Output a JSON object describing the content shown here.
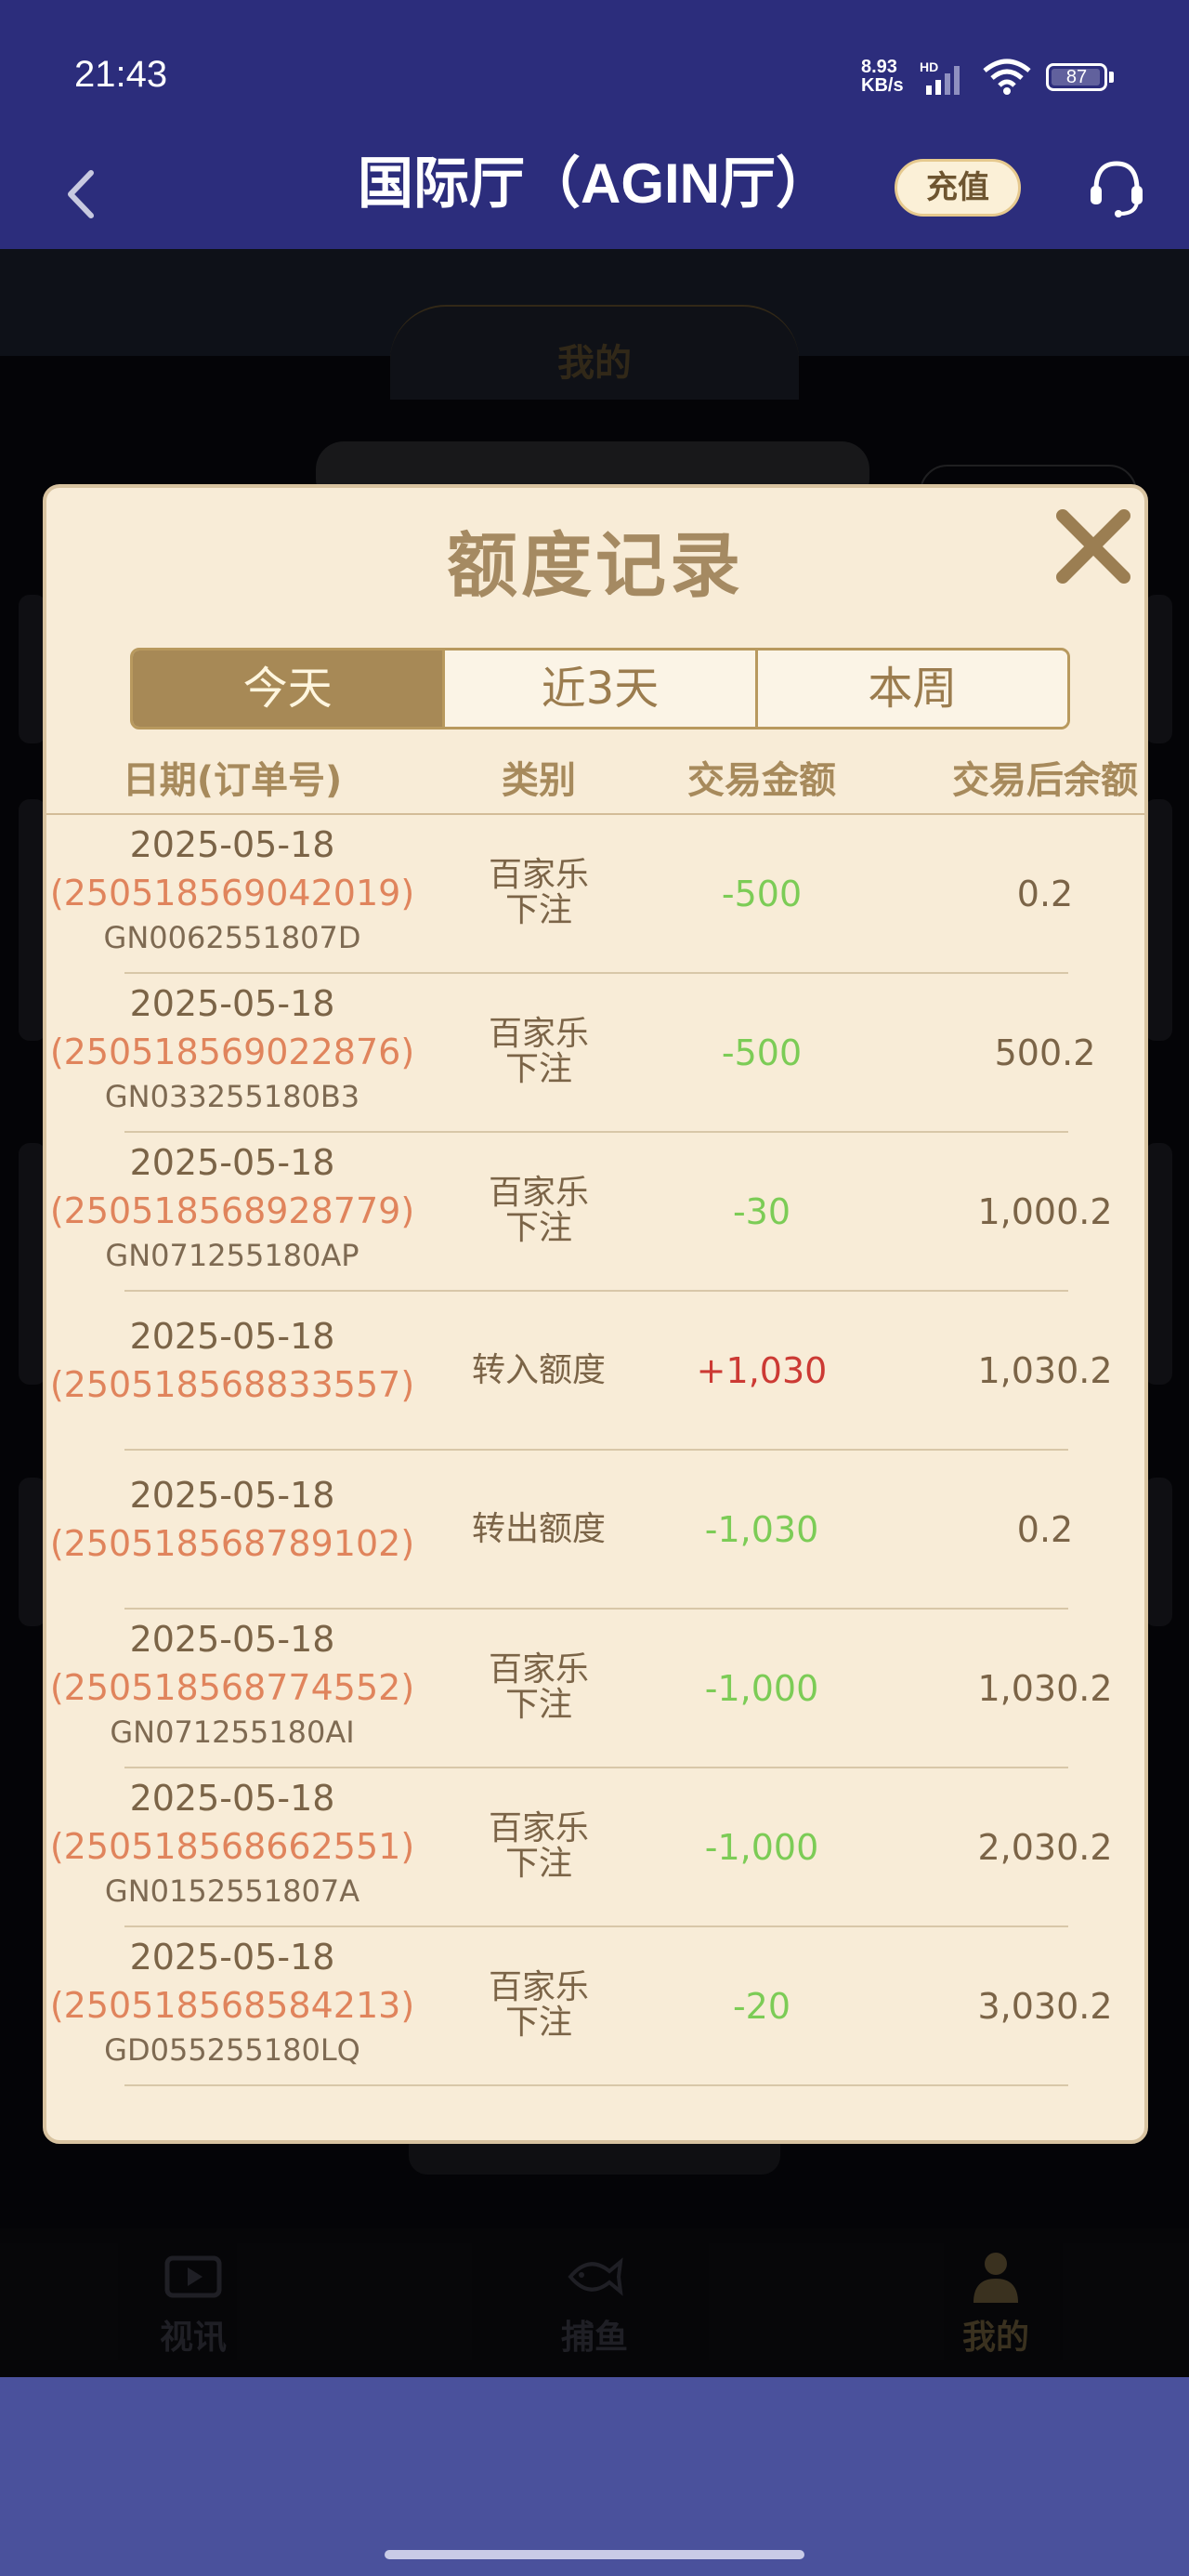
{
  "status_bar": {
    "time": "21:43",
    "net_speed_value": "8.93",
    "net_speed_unit": "KB/s",
    "net_type": "HD",
    "battery": "87"
  },
  "header": {
    "title": "国际厅（AGIN厅）",
    "recharge_label": "充值"
  },
  "background": {
    "tab_label": "我的"
  },
  "bottom_nav": {
    "items": [
      {
        "label": "视讯",
        "icon": "video-icon"
      },
      {
        "label": "捕鱼",
        "icon": "fish-icon"
      },
      {
        "label": "我的",
        "icon": "user-icon"
      }
    ]
  },
  "modal": {
    "title": "额度记录",
    "tabs": [
      {
        "label": "今天",
        "active": true
      },
      {
        "label": "近3天",
        "active": false
      },
      {
        "label": "本周",
        "active": false
      }
    ],
    "columns": {
      "date": "日期(订单号)",
      "type": "类别",
      "amount": "交易金额",
      "balance": "交易后余额"
    },
    "rows": [
      {
        "date": "2025-05-18",
        "order": "(250518569042019)",
        "gn": "GN0062551807D",
        "type": "百家乐下注",
        "amount": "-500",
        "balance": "0.2"
      },
      {
        "date": "2025-05-18",
        "order": "(250518569022876)",
        "gn": "GN033255180B3",
        "type": "百家乐下注",
        "amount": "-500",
        "balance": "500.2"
      },
      {
        "date": "2025-05-18",
        "order": "(250518568928779)",
        "gn": "GN071255180AP",
        "type": "百家乐下注",
        "amount": "-30",
        "balance": "1,000.2"
      },
      {
        "date": "2025-05-18",
        "order": "(250518568833557)",
        "gn": "",
        "type": "转入额度",
        "amount": "+1,030",
        "balance": "1,030.2"
      },
      {
        "date": "2025-05-18",
        "order": "(250518568789102)",
        "gn": "",
        "type": "转出额度",
        "amount": "-1,030",
        "balance": "0.2"
      },
      {
        "date": "2025-05-18",
        "order": "(250518568774552)",
        "gn": "GN071255180AI",
        "type": "百家乐下注",
        "amount": "-1,000",
        "balance": "1,030.2"
      },
      {
        "date": "2025-05-18",
        "order": "(250518568662551)",
        "gn": "GN0152551807A",
        "type": "百家乐下注",
        "amount": "-1,000",
        "balance": "2,030.2"
      },
      {
        "date": "2025-05-18",
        "order": "(250518568584213)",
        "gn": "GD055255180LQ",
        "type": "百家乐下注",
        "amount": "-20",
        "balance": "3,030.2"
      }
    ]
  },
  "colors": {
    "header_bg": "#2c2d7c",
    "modal_bg": "#f8ecd7",
    "accent_gold": "#a78956",
    "negative": "#7ccc56",
    "positive": "#cc3a34",
    "order_color": "#e0845c"
  }
}
